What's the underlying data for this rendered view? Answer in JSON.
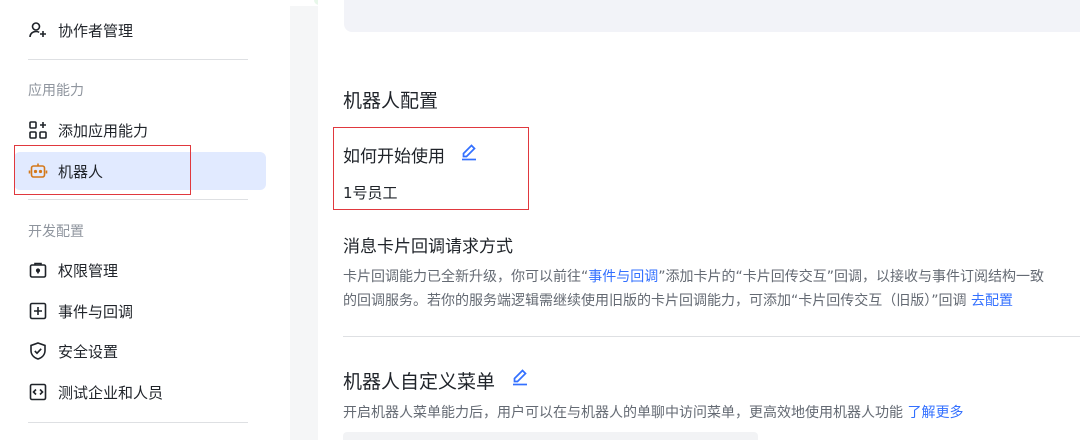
{
  "sidebar": {
    "collab": {
      "label": "协作者管理",
      "icon": "user-add-icon"
    },
    "section_app": "应用能力",
    "add_app": {
      "label": "添加应用能力",
      "icon": "apps-add-icon"
    },
    "bot": {
      "label": "机器人",
      "icon": "robot-icon"
    },
    "section_dev": "开发配置",
    "permission": {
      "label": "权限管理",
      "icon": "lock-box-icon"
    },
    "events": {
      "label": "事件与回调",
      "icon": "plus-box-icon"
    },
    "security": {
      "label": "安全设置",
      "icon": "shield-check-icon"
    },
    "test_org": {
      "label": "测试企业和人员",
      "icon": "code-box-icon"
    }
  },
  "main": {
    "bot_config_title": "机器人配置",
    "how_to_start_label": "如何开始使用",
    "how_to_start_value": "1号员工",
    "callback_title": "消息卡片回调请求方式",
    "callback_line1_a": "卡片回调能力已全新升级，你可以前往“",
    "callback_line1_link": "事件与回调",
    "callback_line1_b": "”添加卡片的“卡片回传交互”回调，以接收与事件订阅结构一致",
    "callback_line2": "的回调服务。若你的服务端逻辑需继续使用旧版的卡片回调能力，可添加“卡片回传交互（旧版）”回调 ",
    "callback_line2_link": "去配置",
    "menu_title": "机器人自定义菜单",
    "menu_desc": "开启机器人菜单能力后，用户可以在与机器人的单聊中访问菜单，更高效地使用机器人功能 ",
    "menu_desc_link": "了解更多"
  },
  "colors": {
    "accent": "#3370ff",
    "active_bg": "#e1eaff",
    "highlight_box": "#e0383e",
    "robot_icon": "#d4781a"
  }
}
